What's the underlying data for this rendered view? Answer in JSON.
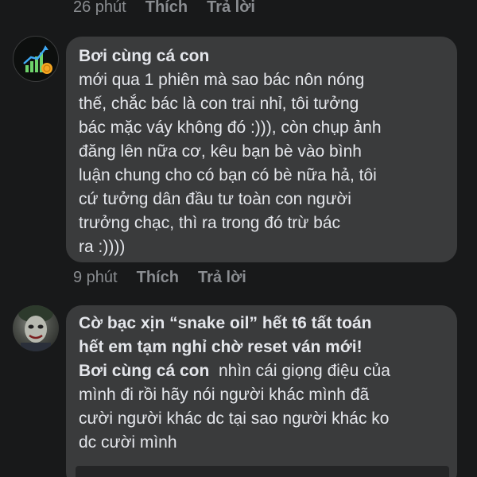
{
  "top_meta": {
    "time": "26 phút",
    "like": "Thích",
    "reply": "Trả lời"
  },
  "comment1": {
    "author": "Bơi cùng cá con",
    "text": "mới qua 1 phiên mà sao bác nôn nóng\nthế, chắc bác là con trai nhỉ, tôi tưởng\nbác mặc váy không đó :))), còn chụp ảnh\nđăng lên nữa cơ, kêu bạn bè vào bình\nluận chung cho có bạn có bè nữa hả, tôi\ncứ tưởng dân đầu tư toàn con người\ntrưởng chạc, thì ra trong đó trừ bác\nra :))))",
    "meta": {
      "time": "9 phút",
      "like": "Thích",
      "reply": "Trả lời"
    }
  },
  "comment2": {
    "author_line1": "Cờ bạc xịn  “snake oil” hết t6 tất toán",
    "author_line2": "hết em tạm nghỉ  chờ reset ván mới!",
    "mention": "Bơi cùng cá con",
    "text_first": "  nhìn cái giọng điệu của",
    "text_rest": "mình đi rồi hãy nói người khác  mình đã\ncười người khác dc tại sao người khác ko\ndc cười mình"
  },
  "colors": {
    "background": "#18191a",
    "bubble": "#3a3b3c",
    "text": "#e4e6eb",
    "meta": "#8a8d91"
  },
  "icons": {
    "avatar1": "growth-chart-coin-icon",
    "avatar2": "joker-face-photo"
  }
}
